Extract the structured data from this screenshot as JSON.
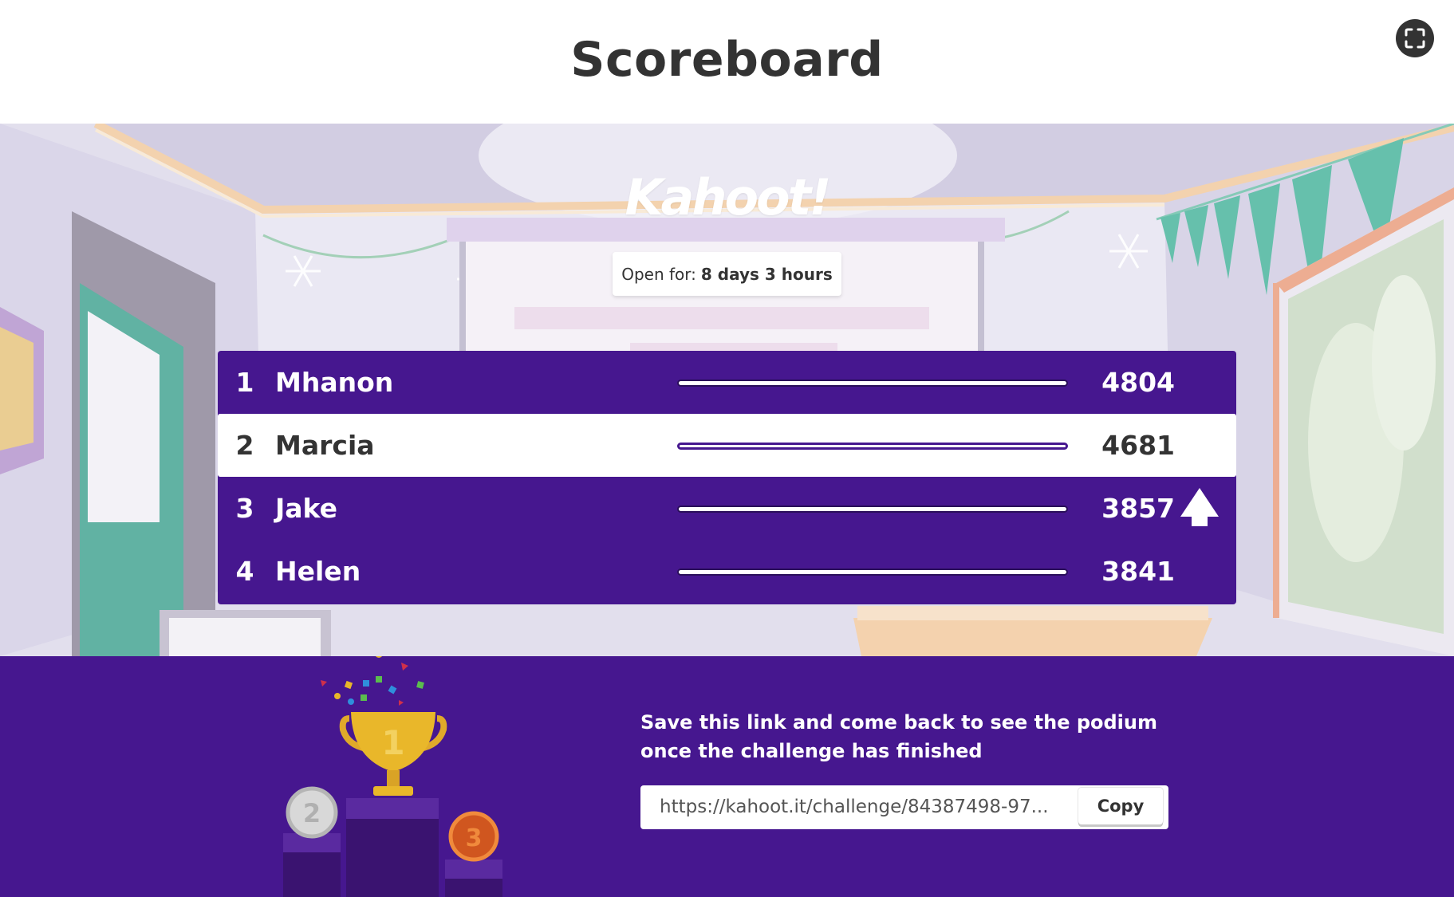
{
  "header": {
    "title": "Scoreboard",
    "fullscreen_icon": "fullscreen-icon"
  },
  "logo": {
    "text": "Kahoot!"
  },
  "open_for": {
    "label": "Open for:",
    "value": "8 days 3 hours"
  },
  "scoreboard": {
    "rows": [
      {
        "rank": "1",
        "name": "Mhanon",
        "score": "4804",
        "highlighted": false,
        "trend_icon": ""
      },
      {
        "rank": "2",
        "name": "Marcia",
        "score": "4681",
        "highlighted": true,
        "trend_icon": ""
      },
      {
        "rank": "3",
        "name": "Jake",
        "score": "3857",
        "highlighted": false,
        "trend_icon": "arrow-up-icon"
      },
      {
        "rank": "4",
        "name": "Helen",
        "score": "3841",
        "highlighted": false,
        "trend_icon": ""
      }
    ]
  },
  "podium_panel": {
    "message": "Save this link and come back to see the podium once the challenge has finished",
    "link_value": "https://kahoot.it/challenge/84387498-97...",
    "copy_label": "Copy",
    "podium_labels": [
      "1",
      "2",
      "3"
    ]
  },
  "colors": {
    "brand_purple": "#46178f",
    "gold": "#e9b72a",
    "silver": "#c9c9c9",
    "bronze": "#d0561f"
  }
}
